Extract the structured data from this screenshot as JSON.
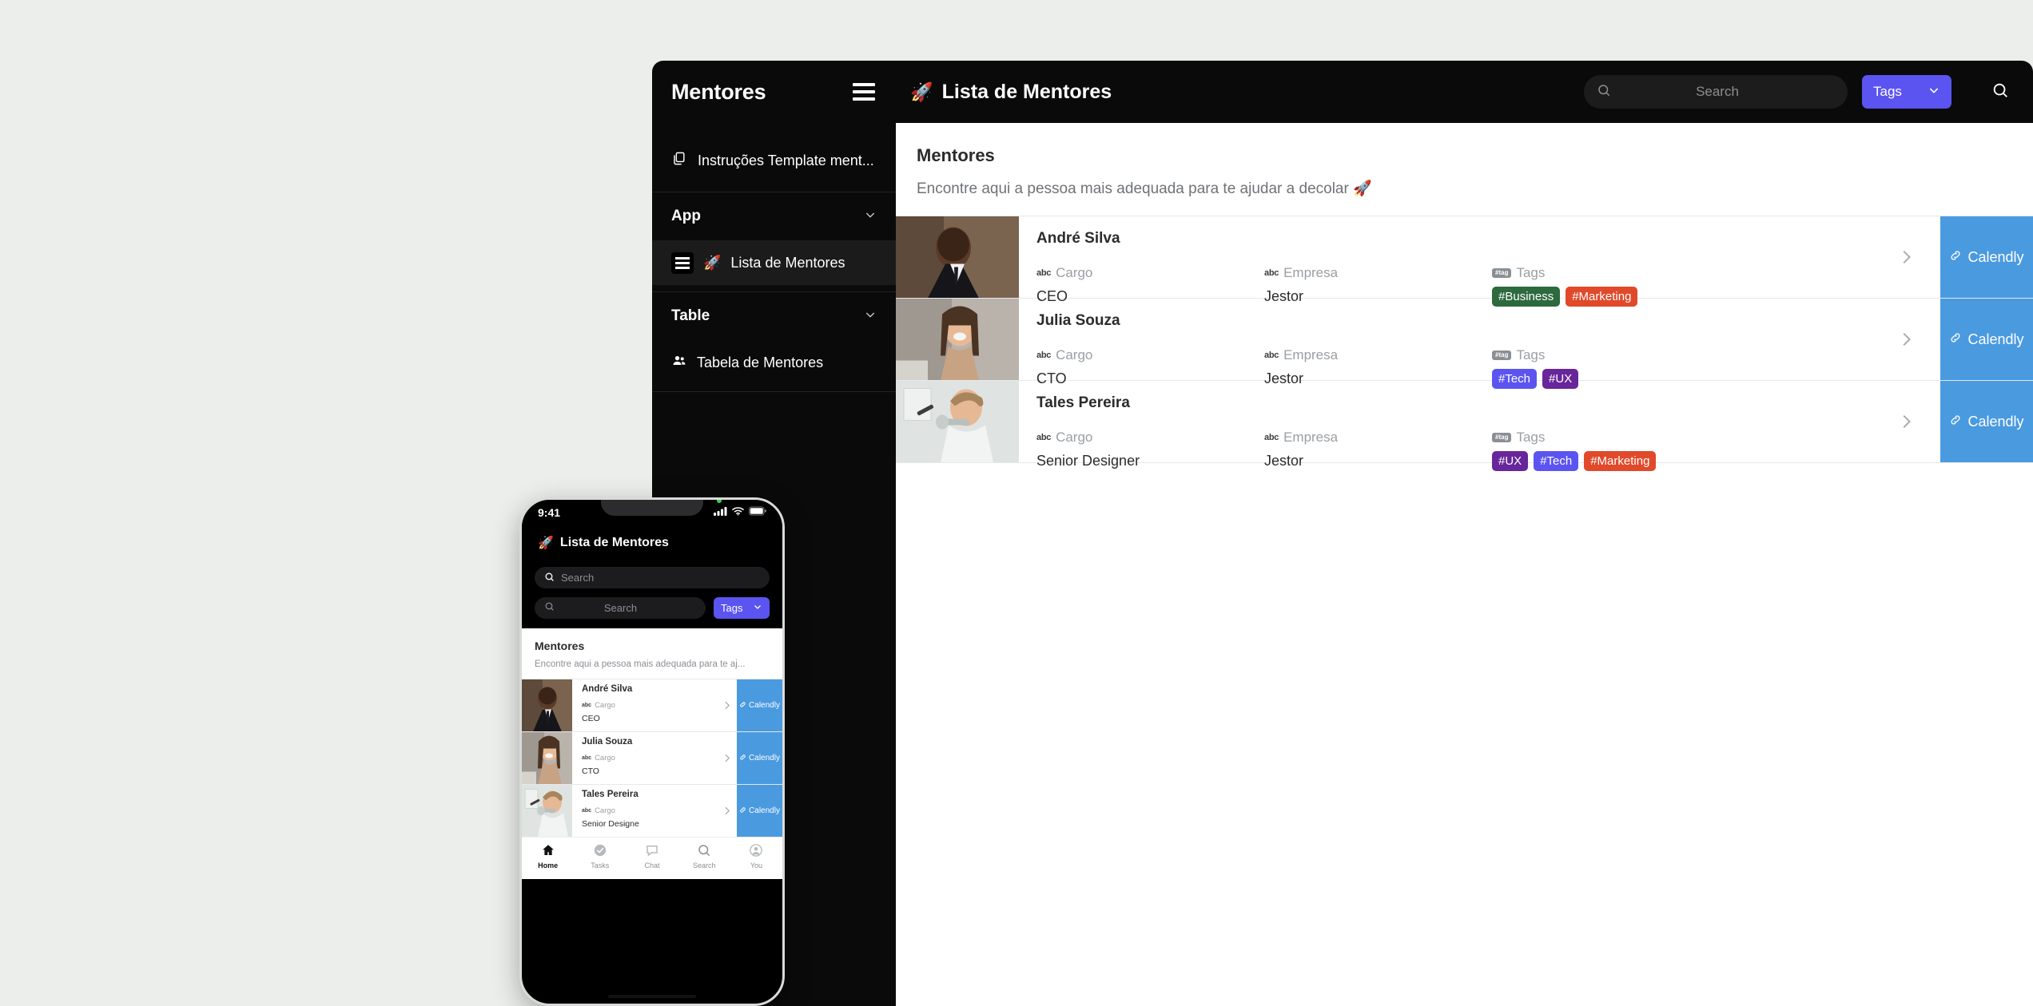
{
  "colors": {
    "accent_purple": "#5b54f0",
    "calendly_blue": "#4a9ae0",
    "panel_dark": "#0a0a0a",
    "page_bg": "#eceeec"
  },
  "desktop": {
    "brand_title": "Mentores",
    "page_title": "Lista de Mentores",
    "page_title_emoji": "🚀",
    "search": {
      "placeholder": "Search"
    },
    "tags_button": {
      "label": "Tags"
    },
    "sidebar": {
      "items": [
        {
          "label": "Instruções Template ment...",
          "icon": "copy-icon",
          "type": "item"
        }
      ],
      "groups": [
        {
          "label": "App",
          "items": [
            {
              "label": "Lista de Mentores",
              "emoji": "🚀",
              "icon": "list-icon",
              "active": true
            }
          ]
        },
        {
          "label": "Table",
          "items": [
            {
              "label": "Tabela de Mentores",
              "icon": "people-icon",
              "active": false
            }
          ]
        }
      ]
    },
    "content": {
      "heading": "Mentores",
      "subheading": "Encontre aqui a pessoa mais adequada para te ajudar a decolar 🚀",
      "field_labels": {
        "cargo": "Cargo",
        "empresa": "Empresa",
        "tags": "Tags"
      },
      "field_icon_cargo": "abc",
      "field_icon_tags": "#tag",
      "calendly_label": "Calendly",
      "rows": [
        {
          "name": "André Silva",
          "cargo": "CEO",
          "empresa": "Jestor",
          "tags": [
            {
              "label": "#Business",
              "color": "#2d6a3e"
            },
            {
              "label": "#Marketing",
              "color": "#e0492a"
            }
          ]
        },
        {
          "name": "Julia Souza",
          "cargo": "CTO",
          "empresa": "Jestor",
          "tags": [
            {
              "label": "#Tech",
              "color": "#5b54f0"
            },
            {
              "label": "#UX",
              "color": "#68269b"
            }
          ]
        },
        {
          "name": "Tales Pereira",
          "cargo": "Senior Designer",
          "empresa": "Jestor",
          "tags": [
            {
              "label": "#UX",
              "color": "#68269b"
            },
            {
              "label": "#Tech",
              "color": "#5b54f0"
            },
            {
              "label": "#Marketing",
              "color": "#e0492a"
            }
          ]
        }
      ]
    }
  },
  "phone": {
    "status": {
      "time": "9:41"
    },
    "title": "Lista de Mentores",
    "title_emoji": "🚀",
    "search_top": {
      "placeholder": "Search"
    },
    "search_second": {
      "placeholder": "Search"
    },
    "tags_button": {
      "label": "Tags"
    },
    "content": {
      "heading": "Mentores",
      "subheading": "Encontre aqui a pessoa mais adequada para te aj...",
      "cargo_label": "Cargo",
      "cargo_icon": "abc",
      "calendly_label": "Calendly",
      "rows": [
        {
          "name": "André Silva",
          "cargo": "CEO"
        },
        {
          "name": "Julia Souza",
          "cargo": "CTO"
        },
        {
          "name": "Tales Pereira",
          "cargo": "Senior Designe"
        }
      ]
    },
    "tabbar": [
      {
        "label": "Home",
        "icon": "home-icon",
        "active": true
      },
      {
        "label": "Tasks",
        "icon": "check-circle-icon",
        "active": false
      },
      {
        "label": "Chat",
        "icon": "chat-bubble-icon",
        "active": false
      },
      {
        "label": "Search",
        "icon": "search-icon",
        "active": false
      },
      {
        "label": "You",
        "icon": "person-circle-icon",
        "active": false
      }
    ]
  }
}
